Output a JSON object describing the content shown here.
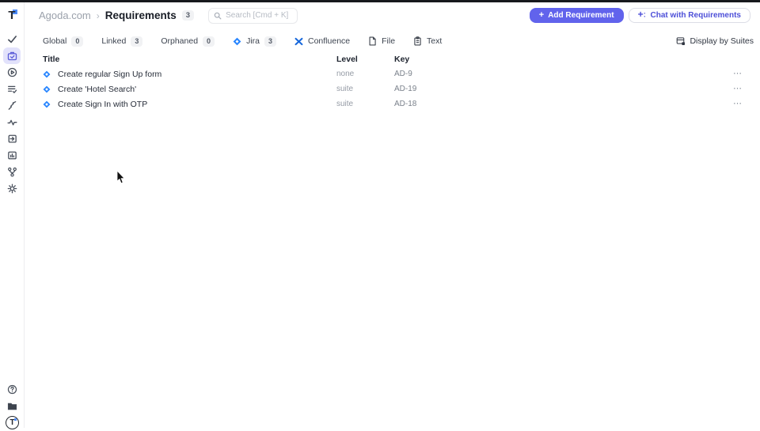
{
  "brand": {
    "logo_letter": "T",
    "avatar_letter": "T"
  },
  "header": {
    "breadcrumb": {
      "project": "Agoda.com",
      "chevron": "›",
      "page": "Requirements",
      "count": "3"
    },
    "search_placeholder": "Search [Cmd + K]",
    "add_button": {
      "plus": "+",
      "label": "Add Requirement"
    },
    "chat_button": {
      "label": "Chat with Requirements"
    }
  },
  "filters": {
    "items": [
      {
        "label": "Global",
        "count": "0"
      },
      {
        "label": "Linked",
        "count": "3"
      },
      {
        "label": "Orphaned",
        "count": "0"
      },
      {
        "label": "Jira",
        "count": "3",
        "icon": "jira-icon"
      },
      {
        "label": "Confluence",
        "icon": "confluence-icon"
      },
      {
        "label": "File",
        "icon": "file-icon"
      },
      {
        "label": "Text",
        "icon": "clipboard-icon"
      }
    ],
    "display_by_suites": "Display by Suites"
  },
  "table": {
    "columns": {
      "title": "Title",
      "level": "Level",
      "key": "Key"
    },
    "rows": [
      {
        "title": "Create regular Sign Up form",
        "level": "none",
        "key": "AD-9"
      },
      {
        "title": "Create 'Hotel Search'",
        "level": "suite",
        "key": "AD-19"
      },
      {
        "title": "Create Sign In with OTP",
        "level": "suite",
        "key": "AD-18"
      }
    ],
    "row_menu_glyph": "⋯"
  },
  "sidebar": {
    "icons": [
      "check-icon",
      "requirements-icon",
      "runs-icon",
      "list-check-icon",
      "wand-icon",
      "pulse-icon",
      "import-icon",
      "analytics-icon",
      "branch-icon",
      "gear-icon",
      "help-icon",
      "folder-icon",
      "user-avatar"
    ]
  },
  "colors": {
    "accent": "#6163ec",
    "accent_light_bg": "#e2e2fb",
    "jira_blue": "#2684FF",
    "confluence_blue": "#1868DB",
    "badge_bg": "#f1f2f4",
    "topbar": "#17191d"
  }
}
